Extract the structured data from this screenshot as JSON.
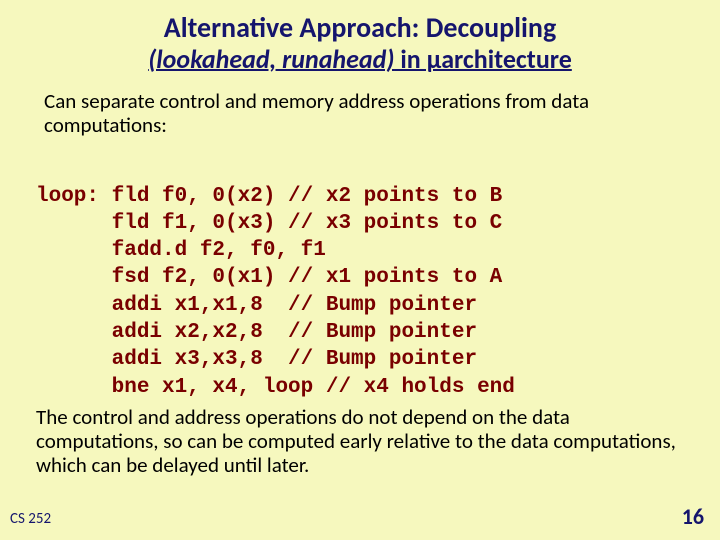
{
  "title": {
    "line1": "Alternative Approach: Decoupling",
    "line2_em": "(lookahead, runahead)",
    "line2_rest": " in µarchitecture"
  },
  "intro": "Can separate control and memory address operations from data computations:",
  "code": {
    "l1": "loop: fld f0, 0(x2) // x2 points to B",
    "l2": "      fld f1, 0(x3) // x3 points to C",
    "l3": "      fadd.d f2, f0, f1",
    "l4": "      fsd f2, 0(x1) // x1 points to A",
    "l5": "      addi x1,x1,8  // Bump pointer",
    "l6": "      addi x2,x2,8  // Bump pointer",
    "l7": "      addi x3,x3,8  // Bump pointer",
    "l8": "      bne x1, x4, loop // x4 holds end"
  },
  "outro": "The control and address operations do not depend on the data computations, so can be computed early relative to the data computations, which can be delayed until later.",
  "footer": {
    "course": "CS 252",
    "page": "16"
  }
}
